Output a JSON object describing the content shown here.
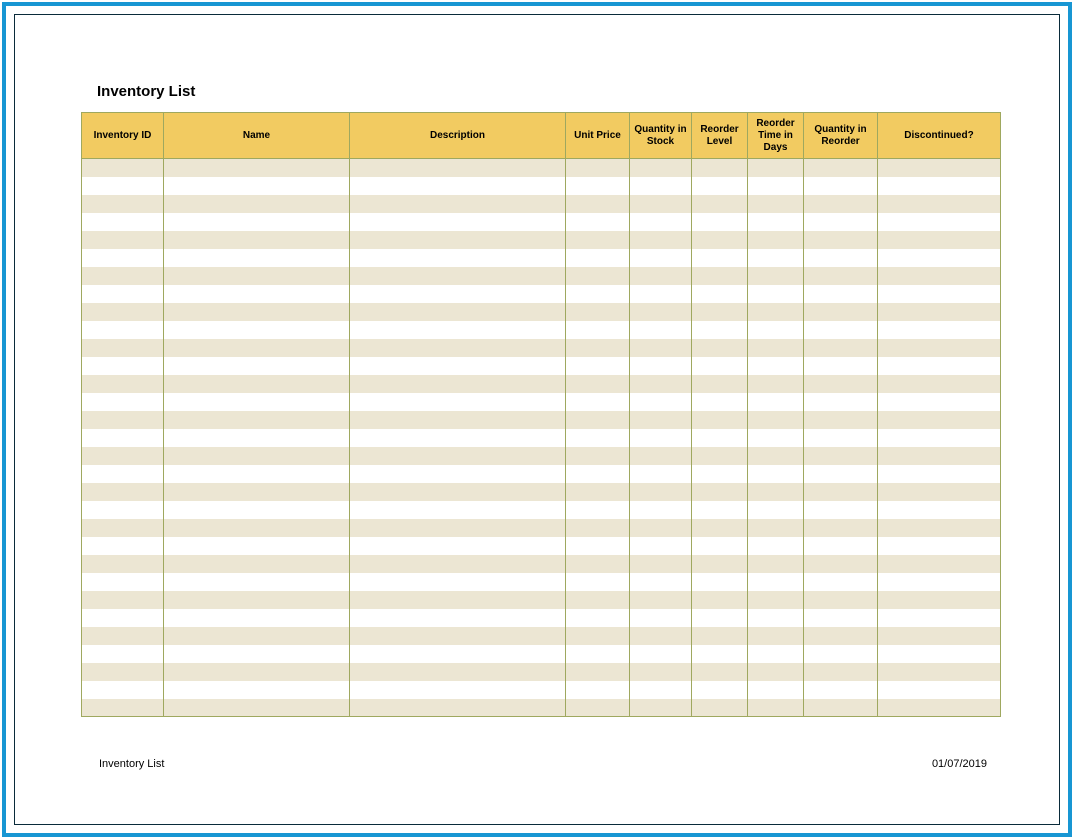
{
  "title": "Inventory List",
  "footer": {
    "left": "Inventory List",
    "right": "01/07/2019"
  },
  "columns": [
    {
      "key": "inventory_id",
      "label": "Inventory ID"
    },
    {
      "key": "name",
      "label": "Name"
    },
    {
      "key": "description",
      "label": "Description"
    },
    {
      "key": "unit_price",
      "label": "Unit Price"
    },
    {
      "key": "qty_stock",
      "label": "Quantity in Stock"
    },
    {
      "key": "reorder_lvl",
      "label": "Reorder Level"
    },
    {
      "key": "reorder_time",
      "label": "Reorder Time in Days"
    },
    {
      "key": "qty_reorder",
      "label": "Quantity in Reorder"
    },
    {
      "key": "discontinued",
      "label": "Discontinued?"
    }
  ],
  "rows": [
    {},
    {},
    {},
    {},
    {},
    {},
    {},
    {},
    {},
    {},
    {},
    {},
    {},
    {},
    {},
    {},
    {},
    {},
    {},
    {},
    {},
    {},
    {},
    {},
    {},
    {},
    {},
    {},
    {},
    {},
    {}
  ]
}
